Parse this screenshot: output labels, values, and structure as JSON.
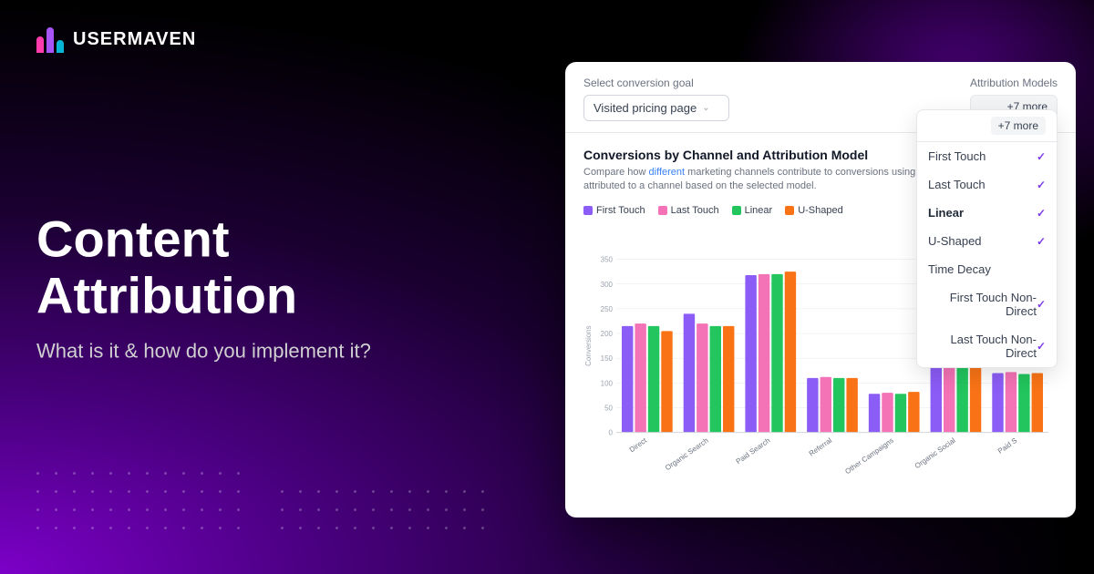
{
  "logo": {
    "text": "USERMAVEN"
  },
  "hero": {
    "title": "Content Attribution",
    "subtitle": "What is it & how do you implement it?"
  },
  "panel": {
    "goal_label": "Select conversion goal",
    "goal_value": "Visited pricing page",
    "attribution_label": "Attribution Models",
    "attribution_tag": "+7 more",
    "chart_title": "Conversions by Channel and Attribution Model",
    "chart_desc_plain": "Compare how different marketing channels contribute to conversions using va",
    "chart_desc_colored": "a",
    "chart_desc_end": "attributed to a channel based on the selected model.",
    "legend": [
      {
        "label": "First Touch",
        "color": "#8b5cf6"
      },
      {
        "label": "Last Touch",
        "color": "#f472b6"
      },
      {
        "label": "Linear",
        "color": "#22c55e"
      },
      {
        "label": "U-Shaped",
        "color": "#f97316"
      },
      {
        "label": "",
        "color": "#eab308"
      }
    ],
    "dropdown_items": [
      {
        "label": "First Touch",
        "checked": true
      },
      {
        "label": "Last Touch",
        "checked": true
      },
      {
        "label": "Linear",
        "checked": true
      },
      {
        "label": "U-Shaped",
        "checked": true
      },
      {
        "label": "Time Decay",
        "checked": false
      },
      {
        "label": "First Touch Non-Direct",
        "checked": true
      },
      {
        "label": "Last Touch Non-Direct",
        "checked": true
      }
    ],
    "chart": {
      "y_label": "Conversions",
      "y_max": 350,
      "y_ticks": [
        0,
        50,
        100,
        150,
        200,
        250,
        300,
        350
      ],
      "channels": [
        {
          "name": "Direct",
          "values": [
            215,
            220,
            215,
            205
          ]
        },
        {
          "name": "Organic Search",
          "values": [
            240,
            220,
            215,
            215
          ]
        },
        {
          "name": "Paid Search",
          "values": [
            318,
            320,
            320,
            325
          ]
        },
        {
          "name": "Referral",
          "values": [
            110,
            112,
            110,
            110
          ]
        },
        {
          "name": "Other Campaigns",
          "values": [
            78,
            80,
            78,
            82
          ]
        },
        {
          "name": "Organic Social",
          "values": [
            145,
            148,
            148,
            145
          ]
        },
        {
          "name": "Paid S",
          "values": [
            120,
            122,
            118,
            120
          ]
        }
      ]
    }
  }
}
